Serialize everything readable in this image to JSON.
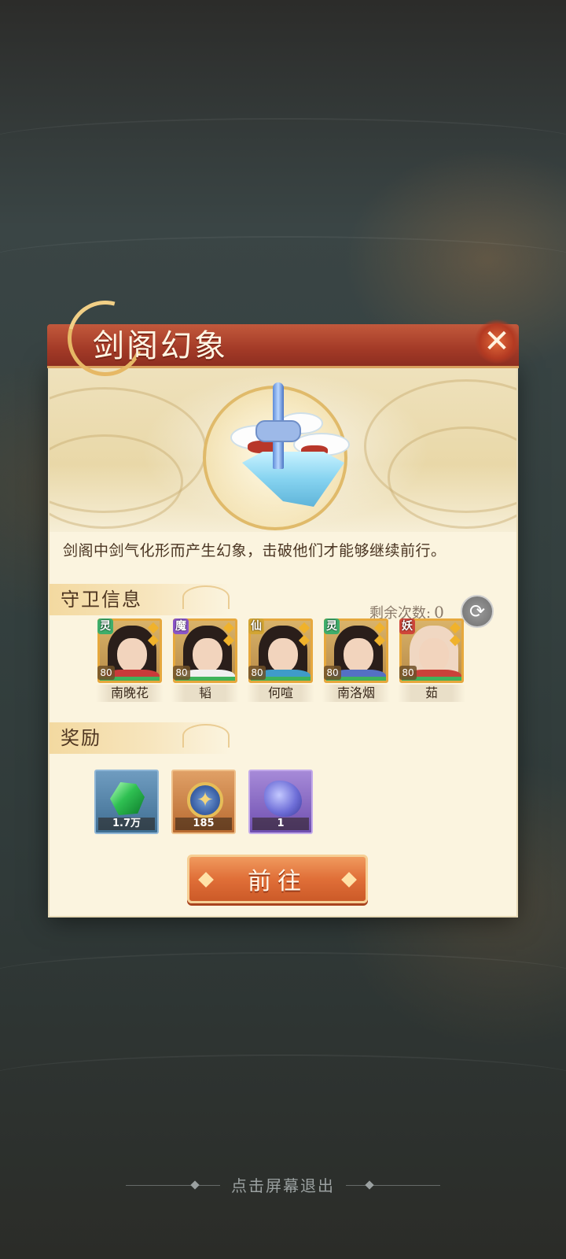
{
  "dialog": {
    "title": "剑阁幻象",
    "close_icon": "close-icon",
    "description": "剑阁中剑气化形而产生幻象，击破他们才能够继续前行。",
    "guard_section": {
      "label": "守卫信息",
      "remaining_label": "剩余次数:",
      "remaining_count": "0",
      "refresh_icon": "refresh-icon"
    },
    "guards": [
      {
        "name": "南晚花",
        "faction": "灵",
        "faction_color": "#3fae6b",
        "level": "80"
      },
      {
        "name": "韬",
        "faction": "魔",
        "faction_color": "#8a55c9",
        "level": "80"
      },
      {
        "name": "何喧",
        "faction": "仙",
        "faction_color": "#d3a533",
        "level": "80"
      },
      {
        "name": "南洛烟",
        "faction": "灵",
        "faction_color": "#3fae6b",
        "level": "80"
      },
      {
        "name": "茹",
        "faction": "妖",
        "faction_color": "#d0463a",
        "level": "80"
      }
    ],
    "reward_section": {
      "label": "奖励"
    },
    "rewards": [
      {
        "icon": "green-gem-icon",
        "quantity": "1.7万",
        "frame_color": "#4f7fa6"
      },
      {
        "icon": "gold-coin-icon",
        "quantity": "185",
        "frame_color": "#c87a3a"
      },
      {
        "icon": "spirit-scroll-icon",
        "quantity": "1",
        "frame_color": "#8c67c2"
      }
    ],
    "go_button": "前往"
  },
  "exit_hint": "点击屏幕退出",
  "colors": {
    "title_bar": "#a33a27",
    "panel_bg": "#fbf4df",
    "button": "#e06f38"
  }
}
